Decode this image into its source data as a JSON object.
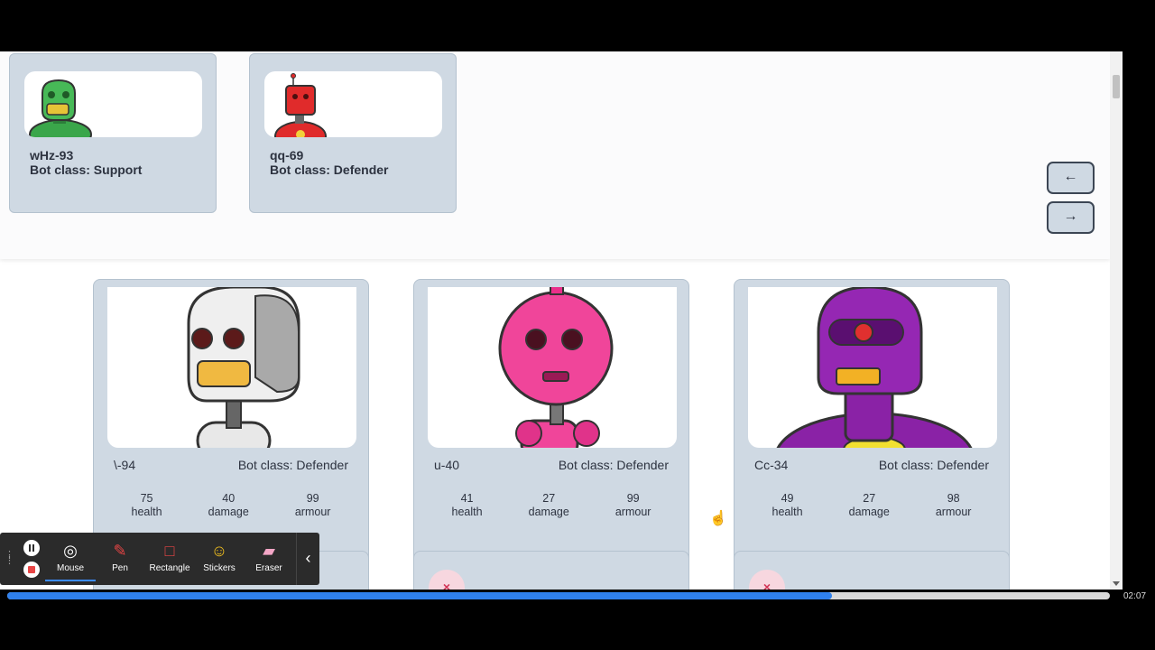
{
  "top_bots": [
    {
      "name": "wHz-93",
      "class_label": "Bot class: Support",
      "color": "#3aa64a",
      "avatar": "green-robot"
    },
    {
      "name": "qq-69",
      "class_label": "Bot class: Defender",
      "color": "#e02b2b",
      "avatar": "red-robot"
    }
  ],
  "nav": {
    "prev_label": "←",
    "next_label": "→"
  },
  "bots": [
    {
      "name": "\\-94",
      "class_label": "Bot class: Defender",
      "color": "#e8e8e8",
      "avatar": "white-robot",
      "health": "75",
      "damage": "40",
      "armour": "99"
    },
    {
      "name": "u-40",
      "class_label": "Bot class: Defender",
      "color": "#f0459a",
      "avatar": "pink-robot",
      "health": "41",
      "damage": "27",
      "armour": "99"
    },
    {
      "name": "Cc-34",
      "class_label": "Bot class: Defender",
      "color": "#8a22a6",
      "avatar": "purple-robot",
      "health": "49",
      "damage": "27",
      "armour": "98"
    }
  ],
  "stat_labels": {
    "health": "health",
    "damage": "damage",
    "armour": "armour"
  },
  "badge_icon": "×",
  "toolbar": {
    "mouse": "Mouse",
    "pen": "Pen",
    "rectangle": "Rectangle",
    "stickers": "Stickers",
    "eraser": "Eraser",
    "collapse": "‹"
  },
  "video": {
    "progress": 0.748,
    "time": "02:07",
    "accent": "#2f80ed"
  }
}
